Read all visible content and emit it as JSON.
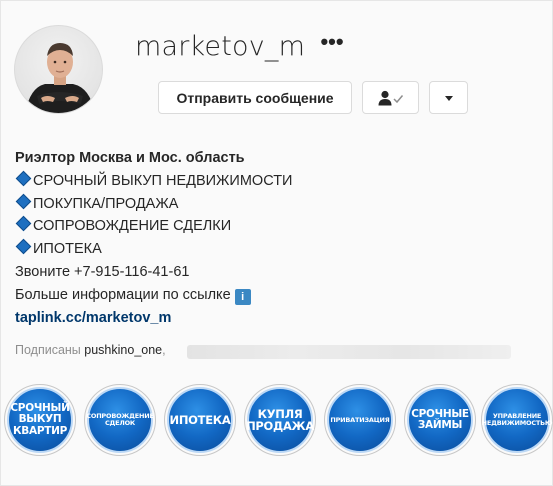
{
  "profile": {
    "username": "marketov_m",
    "more_glyph": "•••",
    "message_button": "Отправить сообщение",
    "follow_icon": "person-check-icon",
    "dropdown_icon": "caret-down-icon"
  },
  "bio": {
    "name": "Риэлтор Москва и Мос. область",
    "lines": [
      "СРОЧНЫЙ ВЫКУП НЕДВИЖИМОСТИ",
      "ПОКУПКА/ПРОДАЖА",
      "СОПРОВОЖДЕНИЕ СДЕЛКИ",
      "ИПОТЕКА"
    ],
    "phone": "Звоните +7-915-116-41-61",
    "more_info": "Больше информации по ссылке",
    "info_badge": "i",
    "link": "taplink.cc/marketov_m"
  },
  "followed_by": {
    "label": "Подписаны",
    "user": "pushkino_one",
    "separator": ","
  },
  "highlights": [
    {
      "label": "Срочный\nвыкуп\nквартир",
      "size": "s-lg"
    },
    {
      "label": "Сопровождение\nсделок",
      "size": "s-sm"
    },
    {
      "label": "Ипотека",
      "size": "s-md"
    },
    {
      "label": "Купля\nпродажа",
      "size": "s-md"
    },
    {
      "label": "Приватизация",
      "size": "s-sm"
    },
    {
      "label": "Срочные\nзаймы",
      "size": "s-lg"
    },
    {
      "label": "Управление\nнедвижимостью",
      "size": "s-sm"
    }
  ]
}
